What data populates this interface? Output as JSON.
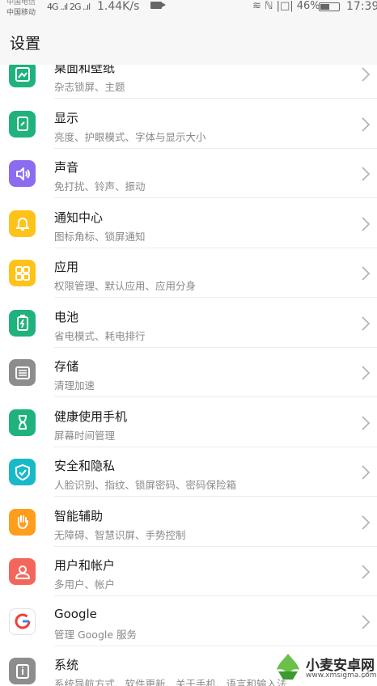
{
  "status_bar": {
    "carrier_top": "中国电信",
    "carrier": "中国移动",
    "signal_1": "4G ..ıl",
    "signal_2": "2G ..ıl",
    "net_speed": "1.44K/s",
    "right_icons": "≋ ℕ |□| 46%",
    "battery_percent": 46,
    "time": "17:39"
  },
  "header": {
    "title": "设置"
  },
  "colors": {
    "wallpaper": "#1fb27c",
    "display": "#1fb27c",
    "sound": "#8b6cf0",
    "notification": "#ffc21a",
    "apps": "#ffc21a",
    "battery": "#1fb27c",
    "storage": "#8d8d8d",
    "digital_balance": "#1fb27c",
    "security": "#19b9c9",
    "accessibility": "#ff9d1c",
    "users": "#f4665b",
    "system": "#8d8d8d"
  },
  "settings": [
    {
      "label": "桌面和壁纸",
      "sub": "杂志锁屏、主题",
      "icon": "wallpaper-icon"
    },
    {
      "label": "显示",
      "sub": "亮度、护眼模式、字体与显示大小",
      "icon": "display-icon"
    },
    {
      "label": "声音",
      "sub": "免打扰、铃声、振动",
      "icon": "sound-icon"
    },
    {
      "label": "通知中心",
      "sub": "图标角标、锁屏通知",
      "icon": "bell-icon"
    },
    {
      "label": "应用",
      "sub": "权限管理、默认应用、应用分身",
      "icon": "apps-grid-icon"
    },
    {
      "label": "电池",
      "sub": "省电模式、耗电排行",
      "icon": "battery-icon"
    },
    {
      "label": "存储",
      "sub": "清理加速",
      "icon": "storage-icon"
    },
    {
      "label": "健康使用手机",
      "sub": "屏幕时间管理",
      "icon": "hourglass-icon"
    },
    {
      "label": "安全和隐私",
      "sub": "人脸识别、指纹、锁屏密码、密码保险箱",
      "icon": "shield-icon"
    },
    {
      "label": "智能辅助",
      "sub": "无障碍、智慧识屏、手势控制",
      "icon": "hand-icon"
    },
    {
      "label": "用户和帐户",
      "sub": "多用户、帐户",
      "icon": "user-icon"
    },
    {
      "label": "Google",
      "sub": "管理 Google 服务",
      "icon": "google-icon"
    },
    {
      "label": "系统",
      "sub": "系统导航方式、软件更新、关于手机、语言和输入法",
      "icon": "system-info-icon"
    }
  ],
  "watermark": {
    "brand": "小麦安卓网",
    "site": "www.xmsigma.com"
  }
}
